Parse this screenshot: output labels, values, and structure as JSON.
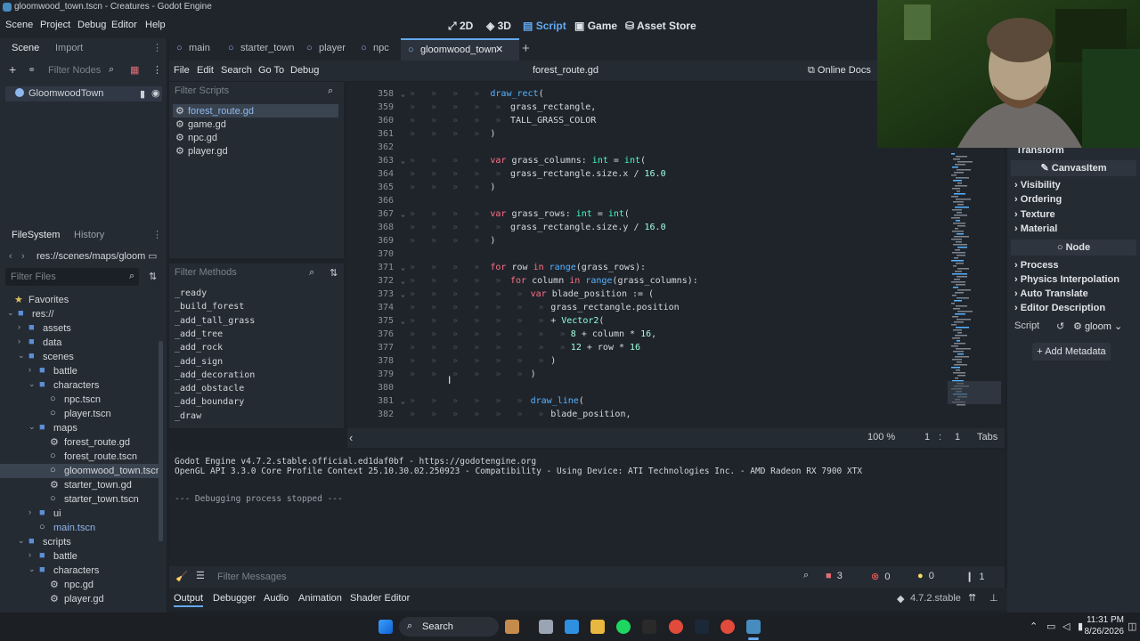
{
  "window": {
    "title": "gloomwood_town.tscn - Creatures - Godot Engine"
  },
  "menubar": {
    "items": [
      "Scene",
      "Project",
      "Debug",
      "Editor",
      "Help"
    ],
    "workspaces": [
      {
        "label": "2D",
        "icon": "2d-icon"
      },
      {
        "label": "3D",
        "icon": "3d-icon"
      },
      {
        "label": "Script",
        "icon": "script-icon",
        "active": true
      },
      {
        "label": "Game",
        "icon": "game-icon"
      },
      {
        "label": "Asset Store",
        "icon": "asset-store-icon"
      }
    ]
  },
  "scene_dock": {
    "tabs": [
      "Scene",
      "Import"
    ],
    "filter_placeholder": "Filter Nodes",
    "root_node": "GloomwoodTown"
  },
  "filesystem_dock": {
    "tabs": [
      "FileSystem",
      "History"
    ],
    "path": "res://scenes/maps/gloom",
    "filter_placeholder": "Filter Files",
    "tree": [
      {
        "label": "Favorites",
        "depth": 0,
        "type": "fav"
      },
      {
        "label": "res://",
        "depth": 0,
        "type": "folder"
      },
      {
        "label": "assets",
        "depth": 1,
        "type": "folder"
      },
      {
        "label": "data",
        "depth": 1,
        "type": "folder"
      },
      {
        "label": "scenes",
        "depth": 1,
        "type": "folder"
      },
      {
        "label": "battle",
        "depth": 2,
        "type": "folder"
      },
      {
        "label": "characters",
        "depth": 2,
        "type": "folder"
      },
      {
        "label": "npc.tscn",
        "depth": 3,
        "type": "scene"
      },
      {
        "label": "player.tscn",
        "depth": 3,
        "type": "scene"
      },
      {
        "label": "maps",
        "depth": 2,
        "type": "folder"
      },
      {
        "label": "forest_route.gd",
        "depth": 3,
        "type": "script"
      },
      {
        "label": "forest_route.tscn",
        "depth": 3,
        "type": "scene"
      },
      {
        "label": "gloomwood_town.tscn",
        "depth": 3,
        "type": "scene",
        "selected": true
      },
      {
        "label": "starter_town.gd",
        "depth": 3,
        "type": "script"
      },
      {
        "label": "starter_town.tscn",
        "depth": 3,
        "type": "scene"
      },
      {
        "label": "ui",
        "depth": 2,
        "type": "folder"
      },
      {
        "label": "main.tscn",
        "depth": 2,
        "type": "scene",
        "link": true
      },
      {
        "label": "scripts",
        "depth": 1,
        "type": "folder"
      },
      {
        "label": "battle",
        "depth": 2,
        "type": "folder"
      },
      {
        "label": "characters",
        "depth": 2,
        "type": "folder"
      },
      {
        "label": "npc.gd",
        "depth": 3,
        "type": "script"
      },
      {
        "label": "player.gd",
        "depth": 3,
        "type": "script"
      }
    ]
  },
  "editor_tabs": {
    "tabs": [
      "main",
      "starter_town",
      "player",
      "npc",
      "gloomwood_town"
    ],
    "active": "gloomwood_town"
  },
  "script_menu": {
    "items": [
      "File",
      "Edit",
      "Search",
      "Go To",
      "Debug"
    ],
    "current_file": "forest_route.gd",
    "online_docs": "Online Docs"
  },
  "scripts_panel": {
    "filter_placeholder": "Filter Scripts",
    "scripts": [
      "forest_route.gd",
      "game.gd",
      "npc.gd",
      "player.gd"
    ],
    "active": "forest_route.gd"
  },
  "methods_panel": {
    "filter_placeholder": "Filter Methods",
    "methods": [
      "_ready",
      "_build_forest",
      "_add_tall_grass",
      "_add_tree",
      "_add_rock",
      "_add_sign",
      "_add_decoration",
      "_add_obstacle",
      "_add_boundary",
      "_draw"
    ]
  },
  "code": {
    "lines": [
      {
        "n": "358",
        "fold": true,
        "t": [
          [
            "fn",
            "draw_rect"
          ],
          [
            "co",
            "("
          ]
        ],
        "indent": 4
      },
      {
        "n": "359",
        "t": [
          [
            "co",
            "grass_rectangle,"
          ]
        ],
        "indent": 5
      },
      {
        "n": "360",
        "t": [
          [
            "co",
            "TALL_GRASS_COLOR"
          ]
        ],
        "indent": 5
      },
      {
        "n": "361",
        "t": [
          [
            "co",
            ")"
          ]
        ],
        "indent": 4
      },
      {
        "n": "362",
        "t": [],
        "indent": 0
      },
      {
        "n": "363",
        "fold": true,
        "t": [
          [
            "kw",
            "var "
          ],
          [
            "co",
            "grass_columns: "
          ],
          [
            "ty",
            "int"
          ],
          [
            "co",
            " = "
          ],
          [
            "ty",
            "int"
          ],
          [
            "co",
            "("
          ]
        ],
        "indent": 4
      },
      {
        "n": "364",
        "t": [
          [
            "co",
            "grass_rectangle.size.x / "
          ],
          [
            "num",
            "16.0"
          ]
        ],
        "indent": 5
      },
      {
        "n": "365",
        "t": [
          [
            "co",
            ")"
          ]
        ],
        "indent": 4
      },
      {
        "n": "366",
        "t": [],
        "indent": 0
      },
      {
        "n": "367",
        "fold": true,
        "t": [
          [
            "kw",
            "var "
          ],
          [
            "co",
            "grass_rows: "
          ],
          [
            "ty",
            "int"
          ],
          [
            "co",
            " = "
          ],
          [
            "ty",
            "int"
          ],
          [
            "co",
            "("
          ]
        ],
        "indent": 4
      },
      {
        "n": "368",
        "t": [
          [
            "co",
            "grass_rectangle.size.y / "
          ],
          [
            "num",
            "16.0"
          ]
        ],
        "indent": 5
      },
      {
        "n": "369",
        "t": [
          [
            "co",
            ")"
          ]
        ],
        "indent": 4
      },
      {
        "n": "370",
        "t": [],
        "indent": 0
      },
      {
        "n": "371",
        "fold": true,
        "t": [
          [
            "kw",
            "for "
          ],
          [
            "co",
            "row "
          ],
          [
            "kw",
            "in "
          ],
          [
            "fn",
            "range"
          ],
          [
            "co",
            "(grass_rows):"
          ]
        ],
        "indent": 4
      },
      {
        "n": "372",
        "fold": true,
        "t": [
          [
            "kw",
            "for "
          ],
          [
            "co",
            "column "
          ],
          [
            "kw",
            "in "
          ],
          [
            "fn",
            "range"
          ],
          [
            "co",
            "(grass_columns):"
          ]
        ],
        "indent": 5
      },
      {
        "n": "373",
        "fold": true,
        "t": [
          [
            "kw",
            "var "
          ],
          [
            "co",
            "blade_position := ("
          ]
        ],
        "indent": 6
      },
      {
        "n": "374",
        "t": [
          [
            "co",
            "grass_rectangle.position"
          ]
        ],
        "indent": 7
      },
      {
        "n": "375",
        "fold": true,
        "t": [
          [
            "co",
            "+ "
          ],
          [
            "bi",
            "Vector2"
          ],
          [
            "co",
            "("
          ]
        ],
        "indent": 7
      },
      {
        "n": "376",
        "t": [
          [
            "num",
            "8"
          ],
          [
            "co",
            " + column * "
          ],
          [
            "num",
            "16"
          ],
          [
            "co",
            ","
          ]
        ],
        "indent": 8
      },
      {
        "n": "377",
        "t": [
          [
            "num",
            "12"
          ],
          [
            "co",
            " + row * "
          ],
          [
            "num",
            "16"
          ]
        ],
        "indent": 8
      },
      {
        "n": "378",
        "t": [
          [
            "co",
            ")"
          ]
        ],
        "indent": 7
      },
      {
        "n": "379",
        "t": [
          [
            "co",
            ")"
          ]
        ],
        "indent": 6
      },
      {
        "n": "380",
        "t": [],
        "indent": 0
      },
      {
        "n": "381",
        "fold": true,
        "t": [
          [
            "fn",
            "draw_line"
          ],
          [
            "co",
            "("
          ]
        ],
        "indent": 6
      },
      {
        "n": "382",
        "t": [
          [
            "co",
            "blade_position,"
          ]
        ],
        "indent": 7
      }
    ]
  },
  "statusbar": {
    "zoom": "100 %",
    "line": "1",
    "col": "1",
    "indent": "Tabs"
  },
  "output": {
    "lines": [
      "Godot Engine v4.7.2.stable.official.ed1daf0bf - https://godotengine.org",
      "OpenGL API 3.3.0 Core Profile Context 25.10.30.02.250923 - Compatibility - Using Device: ATI Technologies Inc. - AMD Radeon RX 7900 XTX",
      "",
      "--- Debugging process stopped ---"
    ],
    "filter_placeholder": "Filter Messages",
    "counts": {
      "errors_total": "3",
      "errors": "0",
      "warnings": "0",
      "messages": "1"
    }
  },
  "bottom_tabs": [
    "Output",
    "Debugger",
    "Audio",
    "Animation",
    "Shader Editor"
  ],
  "version": "4.7.2.stable",
  "inspector": {
    "transform": "Transform",
    "canvas_item": "CanvasItem",
    "sections": [
      "Visibility",
      "Ordering",
      "Texture",
      "Material"
    ],
    "node": "Node",
    "node_sections": [
      "Process",
      "Physics Interpolation",
      "Auto Translate",
      "Editor Description"
    ],
    "script_label": "Script",
    "script_value": "gloom",
    "add_metadata": "Add Metadata"
  },
  "taskbar": {
    "search": "Search",
    "time": "11:31 PM",
    "date": "8/26/2026"
  },
  "colors": {
    "accent": "#63a9f0",
    "keyword": "#ff7085",
    "function": "#57b3ff",
    "type": "#42ffc2"
  }
}
